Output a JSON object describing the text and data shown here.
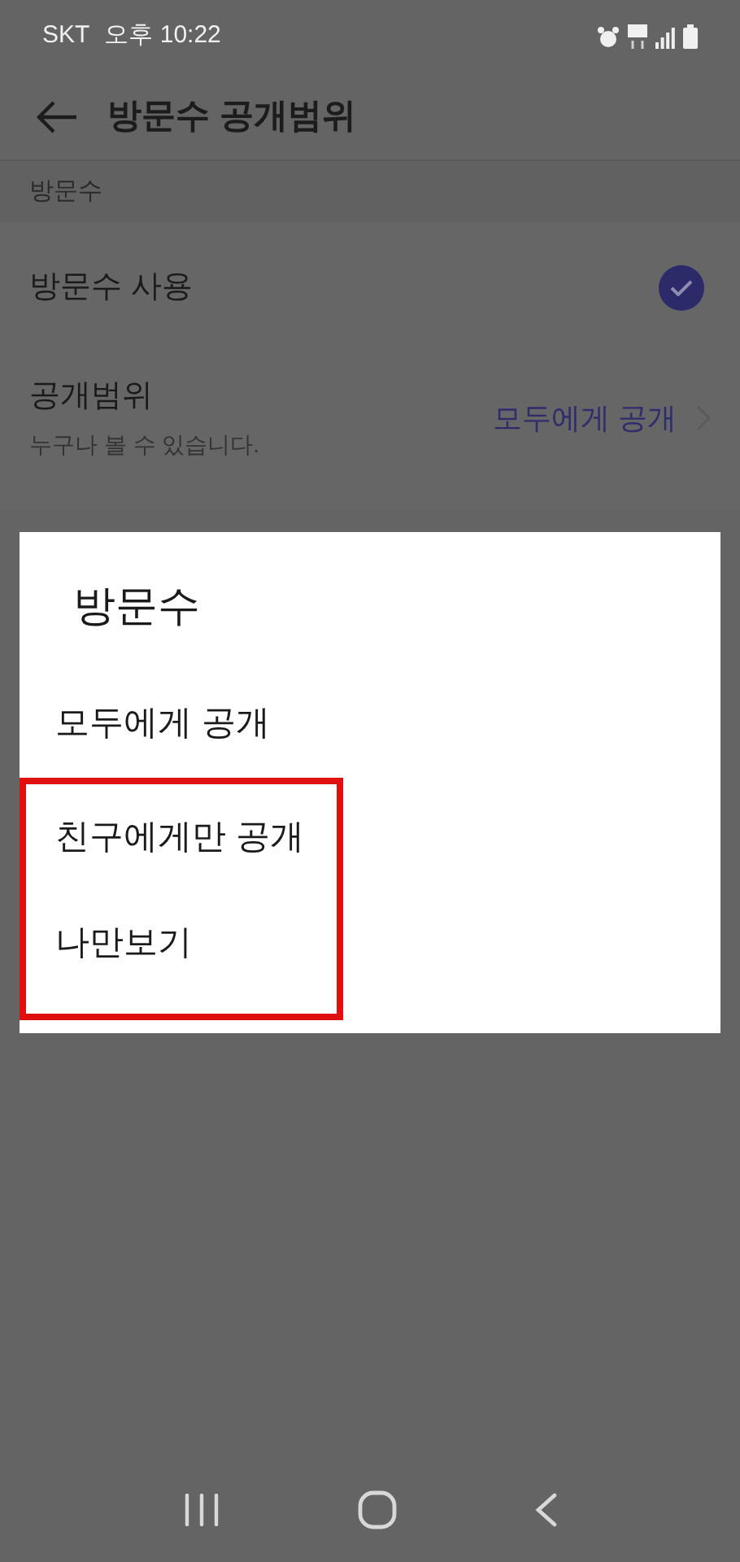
{
  "status_bar": {
    "carrier": "SKT",
    "time": "오후 10:22"
  },
  "header": {
    "title": "방문수 공개범위"
  },
  "section": {
    "title": "방문수",
    "rows": [
      {
        "kind": "check",
        "label": "방문수 사용",
        "checked": true
      },
      {
        "kind": "link",
        "label": "공개범위",
        "subtitle": "누구나 볼 수 있습니다.",
        "value": "모두에게 공개"
      }
    ]
  },
  "dialog": {
    "title": "방문수",
    "options": [
      {
        "label": "모두에게 공개",
        "highlighted": false
      },
      {
        "label": "친구에게만 공개",
        "highlighted": true
      },
      {
        "label": "나만보기",
        "highlighted": true
      }
    ]
  }
}
